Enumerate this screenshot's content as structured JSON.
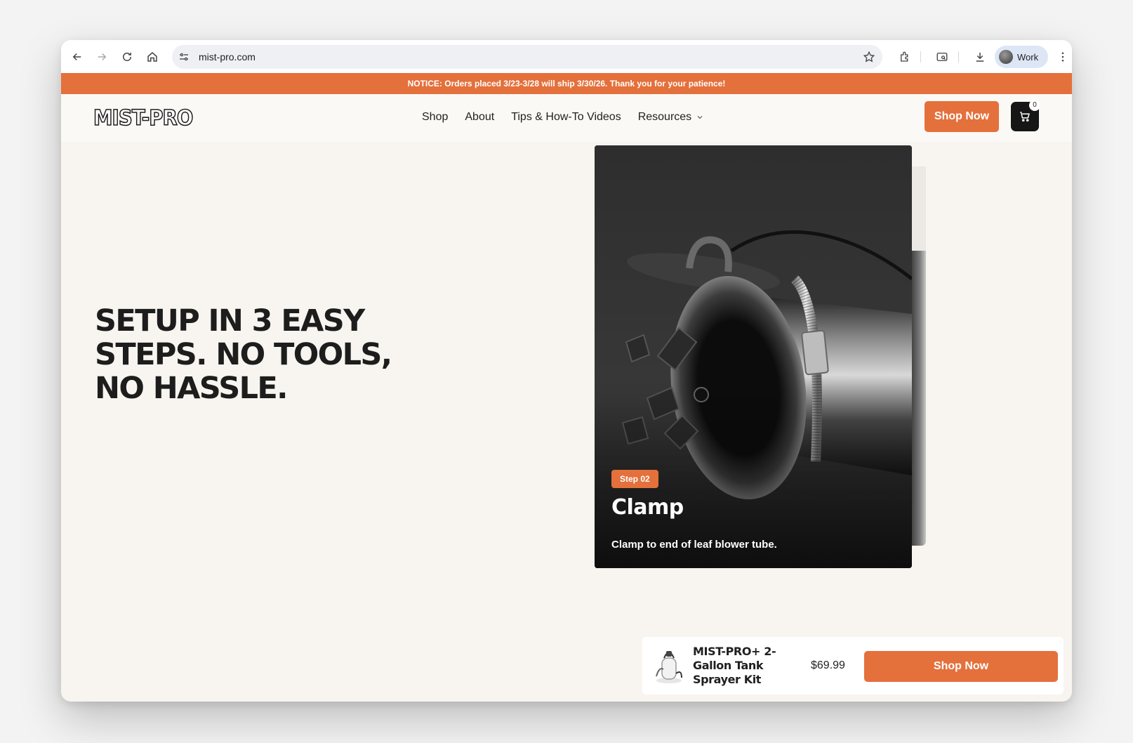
{
  "browser": {
    "url": "mist-pro.com",
    "profile_label": "Work"
  },
  "notice": {
    "text": "NOTICE: Orders placed 3/23-3/28 will ship 3/30/26. Thank you for your patience!"
  },
  "header": {
    "logo_text": "MIST-PRO",
    "nav": [
      {
        "label": "Shop"
      },
      {
        "label": "About"
      },
      {
        "label": "Tips & How-To Videos"
      },
      {
        "label": "Resources"
      }
    ],
    "shop_button": "Shop Now",
    "cart_count": "0"
  },
  "hero": {
    "headline_line1": "SETUP IN 3 EASY",
    "headline_line2a": "STEPS.",
    "headline_line2b": "NO TOOLS,",
    "headline_line3": "NO HASSLE.",
    "card": {
      "badge": "Step 02",
      "title": "Clamp",
      "description": "Clamp to end of leaf blower tube."
    }
  },
  "sticky_bar": {
    "product_name": "MIST-PRO+ 2-Gallon Tank Sprayer Kit",
    "price": "$69.99",
    "button": "Shop Now"
  },
  "colors": {
    "accent": "#e4703c",
    "dark": "#1d1d1d",
    "page_bg": "#f8f5f0"
  }
}
